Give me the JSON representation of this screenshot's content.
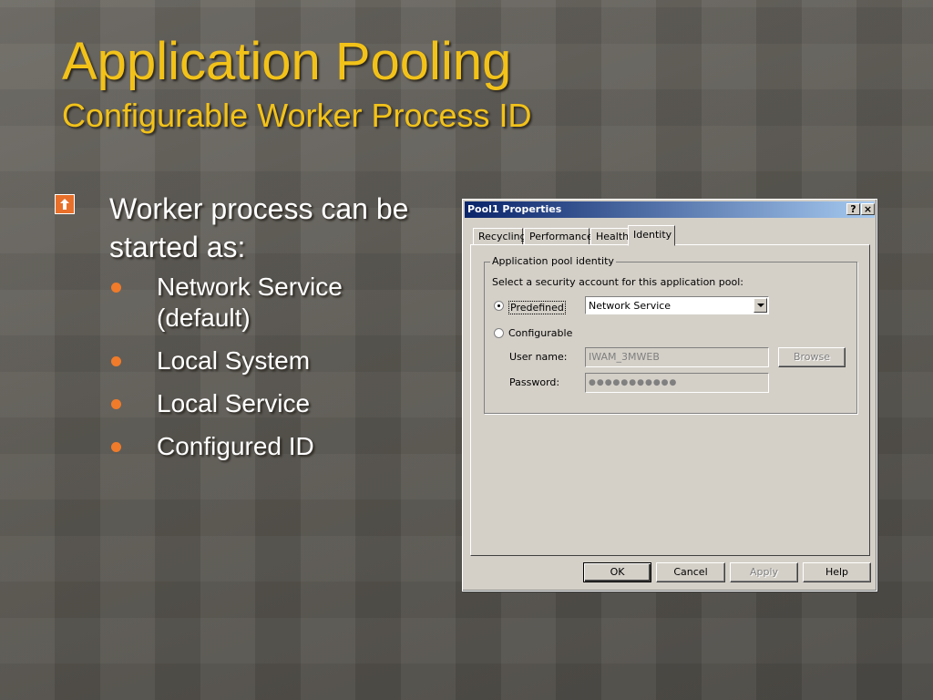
{
  "slide": {
    "title": "Application Pooling",
    "subtitle": "Configurable Worker Process ID",
    "main_bullet": "Worker process can be started as:",
    "sub_bullets": [
      "Network Service (default)",
      "Local System",
      "Local Service",
      "Configured ID"
    ]
  },
  "dialog": {
    "title": "Pool1 Properties",
    "help_button": "?",
    "close_button": "×",
    "tabs": [
      "Recycling",
      "Performance",
      "Health",
      "Identity"
    ],
    "active_tab": "Identity",
    "group_label": "Application pool identity",
    "instruction": "Select a security account for this application pool:",
    "predefined_label": "Predefined",
    "predefined_value": "Network Service",
    "configurable_label": "Configurable",
    "username_label": "User name:",
    "username_value": "IWAM_3MWEB",
    "password_label": "Password:",
    "password_value": "●●●●●●●●●●●",
    "browse_button": "Browse",
    "ok_button": "OK",
    "cancel_button": "Cancel",
    "apply_button": "Apply",
    "help_label": "Help"
  },
  "colors": {
    "title": "#f2c219",
    "bullet_arrow": "#e8702a",
    "bullet_dot": "#f07b2a",
    "titlebar_start": "#0a246a",
    "titlebar_end": "#a6caf0"
  },
  "icons": {
    "main_bullet": "arrow-up-box-icon",
    "sub_bullet": "dot-icon"
  }
}
